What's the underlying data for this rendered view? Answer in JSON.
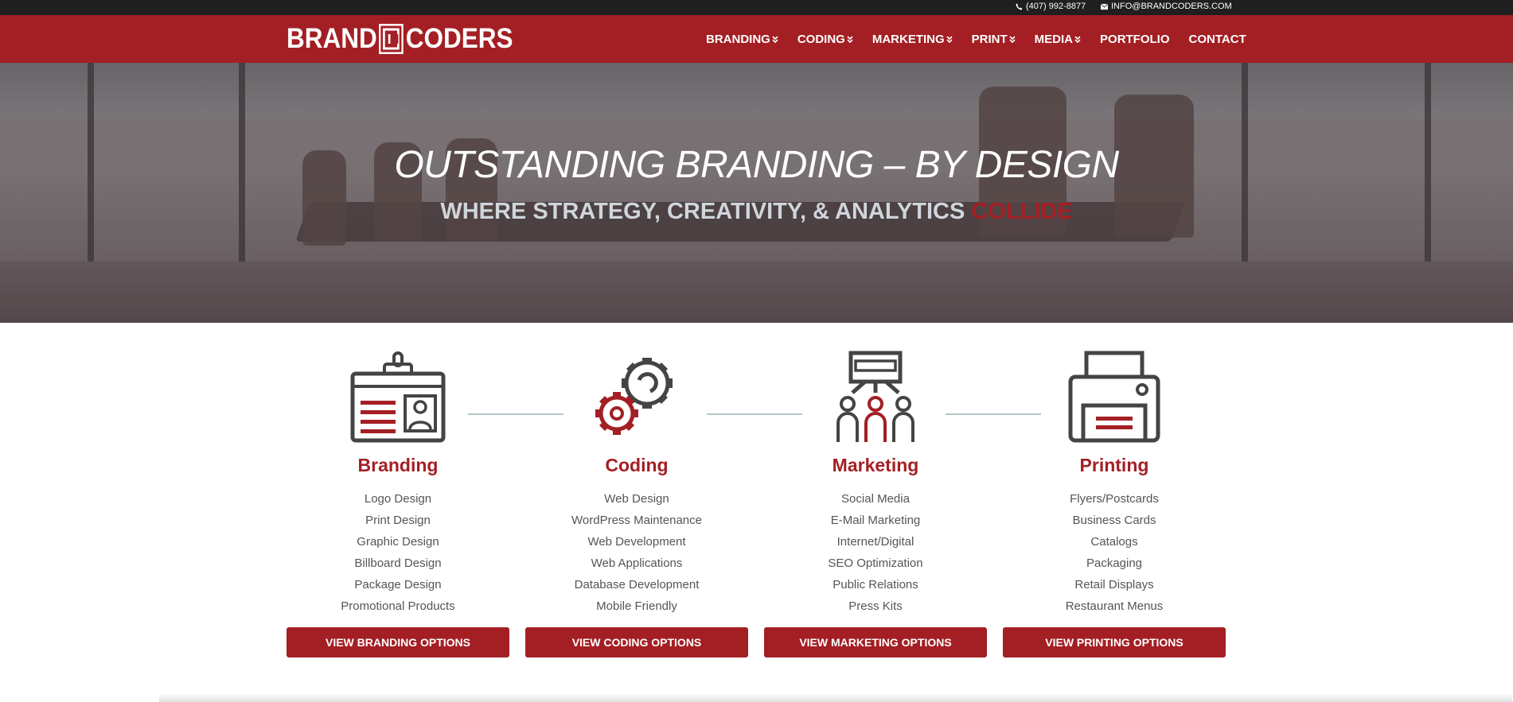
{
  "topbar": {
    "phone": "(407) 992-8877",
    "email": "INFO@BRANDCODERS.COM"
  },
  "header": {
    "logo_left": "BRAND",
    "logo_right": "CODERS",
    "nav": [
      {
        "label": "BRANDING",
        "dropdown": true
      },
      {
        "label": "CODING",
        "dropdown": true
      },
      {
        "label": "MARKETING",
        "dropdown": true
      },
      {
        "label": "PRINT",
        "dropdown": true
      },
      {
        "label": "MEDIA",
        "dropdown": true
      },
      {
        "label": "PORTFOLIO",
        "dropdown": false
      },
      {
        "label": "CONTACT",
        "dropdown": false
      }
    ]
  },
  "hero": {
    "title": "OUTSTANDING BRANDING – BY DESIGN",
    "subtitle": "WHERE STRATEGY, CREATIVITY, & ANALYTICS",
    "subtitle_accent": "COLLIDE"
  },
  "services": [
    {
      "title": "Branding",
      "icon": "id-badge-icon",
      "items": [
        "Logo Design",
        "Print Design",
        "Graphic Design",
        "Billboard Design",
        "Package Design",
        "Promotional Products"
      ],
      "button": "VIEW BRANDING OPTIONS"
    },
    {
      "title": "Coding",
      "icon": "gears-icon",
      "items": [
        "Web Design",
        "WordPress Maintenance",
        "Web Development",
        "Web Applications",
        "Database Development",
        "Mobile Friendly"
      ],
      "button": "VIEW CODING OPTIONS"
    },
    {
      "title": "Marketing",
      "icon": "presentation-audience-icon",
      "items": [
        "Social Media",
        "E-Mail Marketing",
        "Internet/Digital",
        "SEO Optimization",
        "Public Relations",
        "Press Kits"
      ],
      "button": "VIEW MARKETING OPTIONS"
    },
    {
      "title": "Printing",
      "icon": "printer-icon",
      "items": [
        "Flyers/Postcards",
        "Business Cards",
        "Catalogs",
        "Packaging",
        "Retail Displays",
        "Restaurant Menus"
      ],
      "button": "VIEW PRINTING OPTIONS"
    }
  ],
  "colors": {
    "brand_red": "#a31f24",
    "topbar": "#1f1f1f",
    "icon_gray": "#444444",
    "connector": "#b8c6cc"
  }
}
